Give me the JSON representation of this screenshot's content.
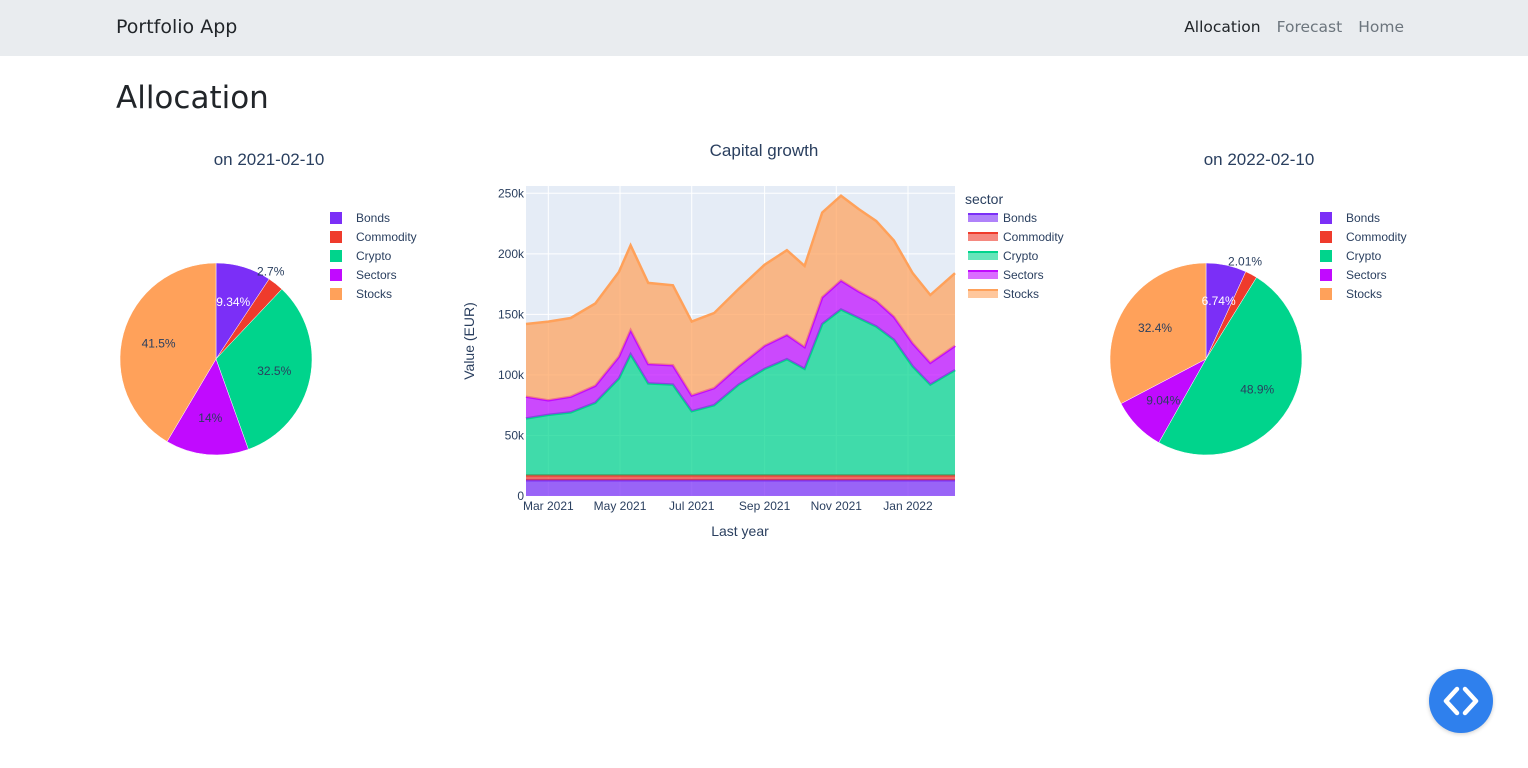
{
  "navbar": {
    "brand": "Portfolio App",
    "links": [
      {
        "label": "Allocation",
        "active": true
      },
      {
        "label": "Forecast",
        "active": false
      },
      {
        "label": "Home",
        "active": false
      }
    ]
  },
  "page": {
    "title": "Allocation"
  },
  "colors": {
    "Bonds": "#7b2ff7",
    "Commodity": "#ef3b2c",
    "Crypto": "#00d48c",
    "Sectors": "#c10aff",
    "Stocks": "#ffa15a"
  },
  "chart_data": [
    {
      "type": "pie",
      "title": "on 2021-02-10",
      "labels": [
        "Bonds",
        "Commodity",
        "Crypto",
        "Sectors",
        "Stocks"
      ],
      "values": [
        9.34,
        2.7,
        32.5,
        14,
        41.5
      ],
      "text_labels": [
        "9.34%",
        "2.7%",
        "32.5%",
        "14%",
        "41.5%"
      ],
      "legend_placement": "right"
    },
    {
      "type": "area",
      "title": "Capital growth",
      "xlabel": "Last year",
      "ylabel": "Value (EUR)",
      "legend_title": "sector",
      "legend_placement": "right",
      "x_tick_labels": [
        "Mar 2021",
        "May 2021",
        "Jul 2021",
        "Sep 2021",
        "Nov 2021",
        "Jan 2022"
      ],
      "x_ticks": [
        "2021-03-01",
        "2021-05-01",
        "2021-07-01",
        "2021-09-01",
        "2021-11-01",
        "2022-01-01"
      ],
      "xlim": [
        "2021-02-10",
        "2022-02-10"
      ],
      "y_tick_labels": [
        "0",
        "50k",
        "100k",
        "150k",
        "200k",
        "250k"
      ],
      "y_ticks": [
        0,
        50000,
        100000,
        150000,
        200000,
        250000
      ],
      "ylim": [
        0,
        256000
      ],
      "grid": true,
      "stacked": true,
      "x": [
        "2021-02-10",
        "2021-03-01",
        "2021-03-20",
        "2021-04-10",
        "2021-04-30",
        "2021-05-10",
        "2021-05-25",
        "2021-06-15",
        "2021-07-01",
        "2021-07-20",
        "2021-08-10",
        "2021-09-01",
        "2021-09-20",
        "2021-10-05",
        "2021-10-20",
        "2021-11-05",
        "2021-11-20",
        "2021-12-05",
        "2021-12-20",
        "2022-01-05",
        "2022-01-20",
        "2022-02-10"
      ],
      "series": [
        {
          "name": "Bonds",
          "values": [
            13000,
            13000,
            13000,
            13000,
            13000,
            13000,
            13000,
            13000,
            13000,
            13000,
            13000,
            13000,
            13000,
            13000,
            13000,
            13000,
            13000,
            13000,
            13000,
            13000,
            13000,
            13000
          ]
        },
        {
          "name": "Commodity",
          "values": [
            4000,
            4000,
            4000,
            4000,
            4000,
            4000,
            4000,
            4000,
            4000,
            4000,
            4000,
            4000,
            4000,
            4000,
            4000,
            4000,
            4000,
            4000,
            4000,
            4000,
            4000,
            4000
          ]
        },
        {
          "name": "Crypto",
          "values": [
            47000,
            50000,
            52000,
            60000,
            80000,
            100000,
            76000,
            75000,
            53000,
            58000,
            75000,
            88000,
            96000,
            88000,
            125000,
            137000,
            130000,
            123000,
            112000,
            90000,
            75000,
            87000
          ]
        },
        {
          "name": "Sectors",
          "values": [
            18000,
            12000,
            13000,
            14000,
            18000,
            20000,
            16000,
            16000,
            13000,
            14000,
            15000,
            19000,
            20000,
            18000,
            22000,
            24000,
            22000,
            21000,
            19000,
            19000,
            18000,
            20000
          ]
        },
        {
          "name": "Stocks",
          "values": [
            60000,
            65000,
            65000,
            68000,
            70000,
            70000,
            67000,
            66000,
            61000,
            62000,
            64000,
            67000,
            70000,
            67000,
            70000,
            70000,
            68000,
            66000,
            63000,
            58000,
            56000,
            60000
          ]
        }
      ]
    },
    {
      "type": "pie",
      "title": "on 2022-02-10",
      "labels": [
        "Bonds",
        "Commodity",
        "Crypto",
        "Sectors",
        "Stocks"
      ],
      "values": [
        6.74,
        2.01,
        48.9,
        9.04,
        32.4
      ],
      "text_labels": [
        "6.74%",
        "2.01%",
        "48.9%",
        "9.04%",
        "32.4%"
      ],
      "legend_placement": "right"
    }
  ]
}
